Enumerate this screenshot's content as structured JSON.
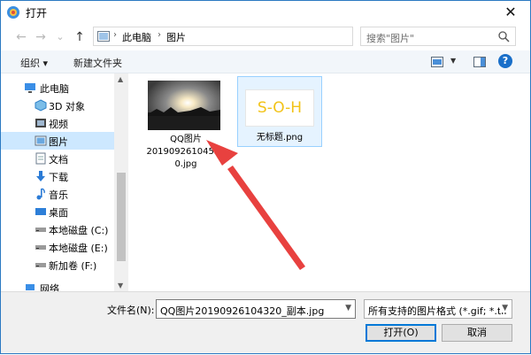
{
  "window": {
    "title": "打开",
    "close_glyph": "✕"
  },
  "nav": {
    "back": "←",
    "forward": "→",
    "recent": "⌄",
    "up": "↑",
    "breadcrumb": [
      "此电脑",
      "图片"
    ],
    "refresh": "↻",
    "search_placeholder": "搜索\"图片\""
  },
  "toolbar": {
    "organize": "组织 ▾",
    "new_folder": "新建文件夹",
    "help": "?"
  },
  "sidebar": {
    "items": [
      {
        "label": "此电脑",
        "icon": "computer-icon"
      },
      {
        "label": "3D 对象",
        "icon": "cube-icon"
      },
      {
        "label": "视频",
        "icon": "video-icon"
      },
      {
        "label": "图片",
        "icon": "pictures-icon",
        "selected": true
      },
      {
        "label": "文档",
        "icon": "document-icon"
      },
      {
        "label": "下载",
        "icon": "download-icon"
      },
      {
        "label": "音乐",
        "icon": "music-icon"
      },
      {
        "label": "桌面",
        "icon": "desktop-icon"
      },
      {
        "label": "本地磁盘 (C:)",
        "icon": "drive-icon"
      },
      {
        "label": "本地磁盘 (E:)",
        "icon": "drive-icon"
      },
      {
        "label": "新加卷 (F:)",
        "icon": "drive-icon"
      },
      {
        "label": "网络",
        "icon": "network-icon"
      }
    ]
  },
  "files": [
    {
      "name_lines": [
        "QQ图片",
        "20190926104532",
        "0.jpg"
      ],
      "thumb": "sunset-photo"
    },
    {
      "name_lines": [
        "无标题.png"
      ],
      "thumb_text": "S-O-H",
      "selected": true
    }
  ],
  "bottom": {
    "filename_label": "文件名(N):",
    "filename_value": "QQ图片20190926104320_副本.jpg",
    "filter_value": "所有支持的图片格式 (*.gif; *.tif",
    "open_label": "打开(O)",
    "cancel_label": "取消"
  },
  "colors": {
    "accent": "#0078d7",
    "selection": "#cde8ff",
    "annotation_arrow": "#e8413f"
  }
}
